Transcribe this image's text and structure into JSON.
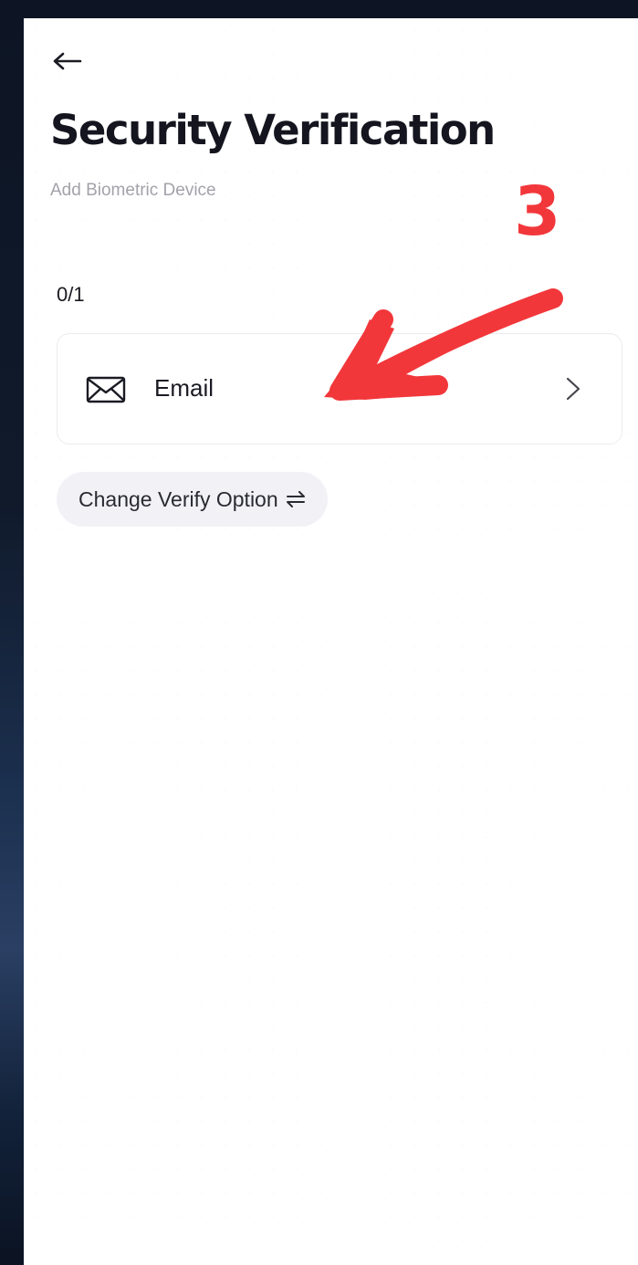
{
  "header": {
    "title": "Security Verification",
    "subtitle": "Add Biometric Device",
    "back_icon": "arrow-left-icon"
  },
  "progress": {
    "text": "0/1"
  },
  "options": [
    {
      "label": "Email",
      "icon": "mail-icon",
      "trailing_icon": "chevron-right-icon"
    }
  ],
  "change_option": {
    "label": "Change Verify Option",
    "icon": "swap-arrows-icon"
  },
  "annotation": {
    "step": "3",
    "color": "#f2373b"
  },
  "colors": {
    "title": "#15151f",
    "subtitle": "#a2a2aa",
    "card_border": "#ececf0",
    "pill_bg": "#f1f1f6",
    "backdrop": "#0c1220"
  }
}
